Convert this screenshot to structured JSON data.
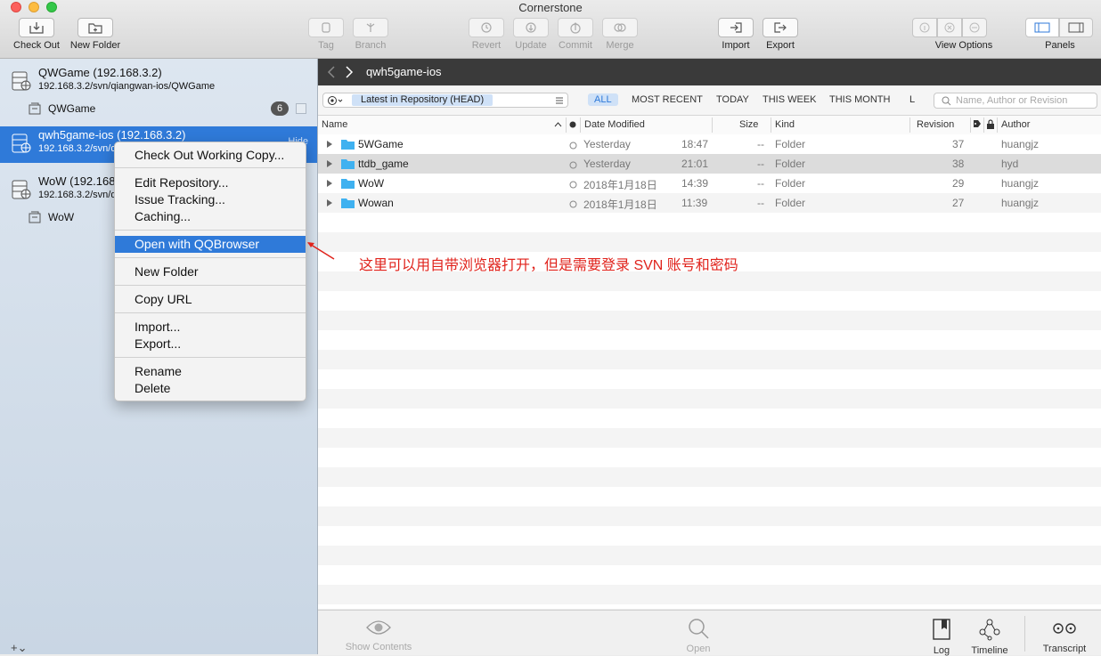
{
  "window": {
    "title": "Cornerstone"
  },
  "toolbar": {
    "checkout": "Check Out",
    "new_folder": "New Folder",
    "tag": "Tag",
    "branch": "Branch",
    "revert": "Revert",
    "update": "Update",
    "commit": "Commit",
    "merge": "Merge",
    "import": "Import",
    "export": "Export",
    "view_options": "View Options",
    "panels": "Panels"
  },
  "sidebar": {
    "repos": [
      {
        "name": "QWGame (192.168.3.2)",
        "url": "192.168.3.2/svn/qiangwan-ios/QWGame",
        "sub": "QWGame",
        "badge": "6"
      },
      {
        "name": "qwh5game-ios (192.168.3.2)",
        "url": "192.168.3.2/svn/qiangwan-ios/qwh5game-ios",
        "hide": "Hide"
      },
      {
        "name": "WoW (192.168.3.2)",
        "url": "192.168.3.2/svn/qiangwan-ios/WoW",
        "sub": "WoW"
      }
    ],
    "add": "+⌄"
  },
  "context_menu": {
    "items": [
      "Check Out Working Copy...",
      "Edit Repository...",
      "Issue Tracking...",
      "Caching...",
      "Open with QQBrowser",
      "New Folder",
      "Copy URL",
      "Import...",
      "Export...",
      "Rename",
      "Delete"
    ]
  },
  "annotation": {
    "text": "这里可以用自带浏览器打开，但是需要登录 SVN 账号和密码",
    "color": "#e0231c"
  },
  "pathbar": {
    "title": "qwh5game-ios"
  },
  "filterbar": {
    "version": "Latest in Repository (HEAD)",
    "filters": [
      "ALL",
      "MOST RECENT",
      "TODAY",
      "THIS WEEK",
      "THIS MONTH",
      "L"
    ],
    "search_placeholder": "Name, Author or Revision"
  },
  "columns": {
    "name": "Name",
    "date": "Date Modified",
    "size": "Size",
    "kind": "Kind",
    "revision": "Revision",
    "author": "Author"
  },
  "files": [
    {
      "name": "5WGame",
      "date": "Yesterday",
      "time": "18:47",
      "size": "--",
      "kind": "Folder",
      "revision": "37",
      "author": "huangjz"
    },
    {
      "name": "ttdb_game",
      "date": "Yesterday",
      "time": "21:01",
      "size": "--",
      "kind": "Folder",
      "revision": "38",
      "author": "hyd"
    },
    {
      "name": "WoW",
      "date": "2018年1月18日",
      "time": "14:39",
      "size": "--",
      "kind": "Folder",
      "revision": "29",
      "author": "huangjz"
    },
    {
      "name": "Wowan",
      "date": "2018年1月18日",
      "time": "11:39",
      "size": "--",
      "kind": "Folder",
      "revision": "27",
      "author": "huangjz"
    }
  ],
  "bottombar": {
    "show_contents": "Show Contents",
    "open": "Open",
    "log": "Log",
    "timeline": "Timeline",
    "transcript": "Transcript"
  },
  "colors": {
    "accent": "#2f7ad9",
    "folder": "#3fb1f0"
  }
}
